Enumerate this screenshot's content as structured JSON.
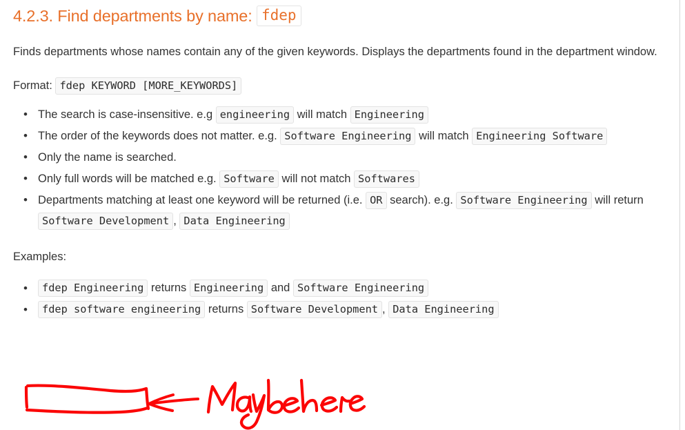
{
  "heading": {
    "number": "4.2.3.",
    "title": "Find departments by name:",
    "command": "fdep"
  },
  "intro": "Finds departments whose names contain any of the given keywords. Displays the departments found in the department window.",
  "format": {
    "label": "Format:",
    "code": "fdep KEYWORD [MORE_KEYWORDS]"
  },
  "notes": [
    {
      "t1": "The search is case-insensitive. e.g",
      "c1": "engineering",
      "t2": "will match",
      "c2": "Engineering"
    },
    {
      "t1": "The order of the keywords does not matter. e.g.",
      "c1": "Software Engineering",
      "t2": "will match",
      "c2": "Engineering Software"
    },
    {
      "t1": "Only the name is searched."
    },
    {
      "t1": "Only full words will be matched e.g.",
      "c1": "Software",
      "t2": "will not match",
      "c2": "Softwares"
    },
    {
      "t1": "Departments matching at least one keyword will be returned (i.e.",
      "c1": "OR",
      "t2": "search). e.g.",
      "c2": "Software Engineering",
      "t3": "will return",
      "c3": "Software Development",
      "sep": ",",
      "c4": "Data Engineering"
    }
  ],
  "examples_label": "Examples:",
  "examples": [
    {
      "c1": "fdep Engineering",
      "t1": "returns",
      "c2": "Engineering",
      "t2": "and",
      "c3": "Software Engineering"
    },
    {
      "c1": "fdep software engineering",
      "t1": "returns",
      "c2": "Software Development",
      "sep": ",",
      "c3": "Data Engineering"
    }
  ],
  "annotation": {
    "text": "Maybe here",
    "color": "#fb0606",
    "shapes": "hand-drawn-rectangle, left-pointing-arrow, handwritten-text"
  },
  "colors": {
    "heading": "#e8702a",
    "body_text": "#333333",
    "code_bg": "#f8f8f8",
    "code_border": "#e2e2e2",
    "page_border": "#d5d5d5",
    "annotation_red": "#fb0606"
  }
}
